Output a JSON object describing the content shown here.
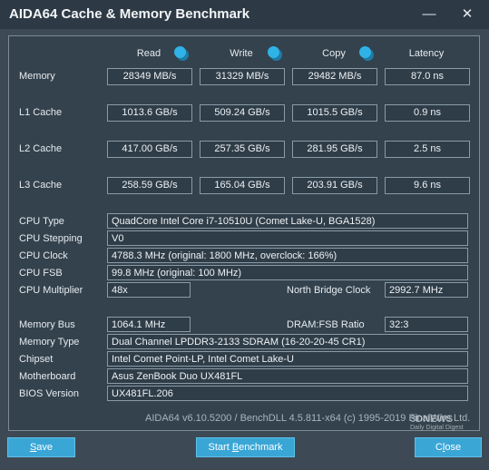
{
  "window": {
    "title": "AIDA64 Cache & Memory Benchmark",
    "minimize_glyph": "—",
    "close_glyph": "✕"
  },
  "headers": {
    "read": "Read",
    "write": "Write",
    "copy": "Copy",
    "latency": "Latency"
  },
  "rows": {
    "memory": {
      "label": "Memory",
      "read": "28349 MB/s",
      "write": "31329 MB/s",
      "copy": "29482 MB/s",
      "latency": "87.0 ns"
    },
    "l1": {
      "label": "L1 Cache",
      "read": "1013.6 GB/s",
      "write": "509.24 GB/s",
      "copy": "1015.5 GB/s",
      "latency": "0.9 ns"
    },
    "l2": {
      "label": "L2 Cache",
      "read": "417.00 GB/s",
      "write": "257.35 GB/s",
      "copy": "281.95 GB/s",
      "latency": "2.5 ns"
    },
    "l3": {
      "label": "L3 Cache",
      "read": "258.59 GB/s",
      "write": "165.04 GB/s",
      "copy": "203.91 GB/s",
      "latency": "9.6 ns"
    }
  },
  "cpu": {
    "type_label": "CPU Type",
    "type_value": "QuadCore Intel Core i7-10510U  (Comet Lake-U, BGA1528)",
    "stepping_label": "CPU Stepping",
    "stepping_value": "V0",
    "clock_label": "CPU Clock",
    "clock_value": "4788.3 MHz  (original: 1800 MHz, overclock: 166%)",
    "fsb_label": "CPU FSB",
    "fsb_value": "99.8 MHz  (original: 100 MHz)",
    "multiplier_label": "CPU Multiplier",
    "multiplier_value": "48x",
    "nb_clock_label": "North Bridge Clock",
    "nb_clock_value": "2992.7 MHz"
  },
  "memory_info": {
    "bus_label": "Memory Bus",
    "bus_value": "1064.1 MHz",
    "dram_fsb_label": "DRAM:FSB Ratio",
    "dram_fsb_value": "32:3",
    "type_label": "Memory Type",
    "type_value": "Dual Channel LPDDR3-2133 SDRAM  (16-20-20-45 CR1)",
    "chipset_label": "Chipset",
    "chipset_value": "Intel Comet Point-LP, Intel Comet Lake-U",
    "motherboard_label": "Motherboard",
    "motherboard_value": "Asus ZenBook Duo UX481FL",
    "bios_label": "BIOS Version",
    "bios_value": "UX481FL.206"
  },
  "footer": {
    "version_text": "AIDA64 v6.10.5200 / BenchDLL 4.5.811-x64  (c) 1995-2019 FinalWire Ltd.",
    "watermark_title": "3DNEWS",
    "watermark_sub": "Daily Digital Digest"
  },
  "buttons": {
    "save_underlined": "S",
    "save_rest": "ave",
    "start_prefix": "Start ",
    "start_underlined": "B",
    "start_rest": "enchmark",
    "close_prefix": "C",
    "close_underlined": "l",
    "close_rest": "ose"
  },
  "colors": {
    "accent": "#3aa6d6",
    "info_icon": "#2fb3e6",
    "background": "#3d4a55"
  }
}
